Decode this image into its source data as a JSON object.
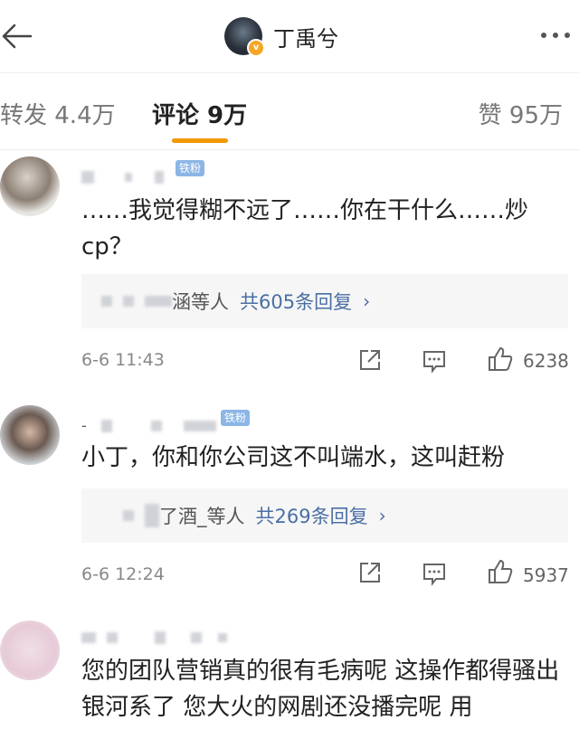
{
  "header": {
    "name": "丁禹兮"
  },
  "tabs": {
    "forward": "转发 4.4万",
    "comments": "评论 9万",
    "likes": "赞 95万"
  },
  "comments": [
    {
      "badge": "铁粉",
      "text": "……我觉得糊不远了……你在干什么……炒cp？",
      "reply_users": "涵等人",
      "reply_count": "共605条回复",
      "time": "6-6 11:43",
      "likes": "6238"
    },
    {
      "badge": "铁粉",
      "text": "小丁，你和你公司这不叫端水，这叫赶粉",
      "reply_users": "了酒_等人",
      "reply_count": "共269条回复",
      "time": "6-6 12:24",
      "likes": "5937"
    },
    {
      "text": "您的团队营销真的很有毛病呢 这操作都得骚出银河系了 您大火的网剧还没播完呢 用"
    }
  ],
  "icons": {
    "back": "back-arrow-icon",
    "more": "more-dots-icon",
    "share": "share-icon",
    "comment": "comment-icon",
    "like": "thumbs-up-icon"
  },
  "colors": {
    "accent": "#f39800",
    "link": "#4a6fa5",
    "badge": "#8bb6e6"
  }
}
